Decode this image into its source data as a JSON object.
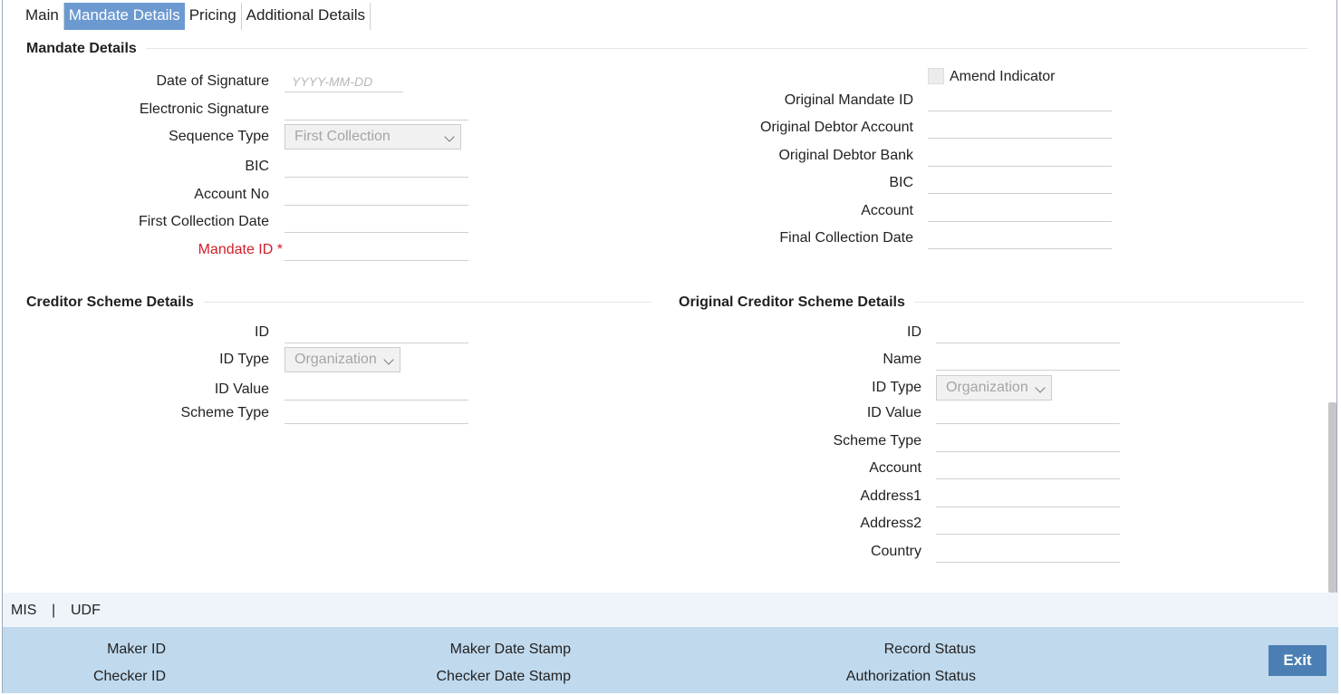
{
  "tabs": [
    {
      "label": "Main"
    },
    {
      "label": "Mandate Details"
    },
    {
      "label": "Pricing"
    },
    {
      "label": "Additional Details"
    }
  ],
  "mandate": {
    "title": "Mandate Details",
    "date_of_signature": {
      "label": "Date of Signature",
      "placeholder": "YYYY-MM-DD"
    },
    "electronic_signature": {
      "label": "Electronic Signature"
    },
    "sequence_type": {
      "label": "Sequence Type",
      "value": "First Collection"
    },
    "bic": {
      "label": "BIC"
    },
    "account_no": {
      "label": "Account No"
    },
    "first_collection_date": {
      "label": "First Collection Date"
    },
    "mandate_id": {
      "label": "Mandate ID",
      "required_mark": "*"
    },
    "amend_indicator": {
      "label": "Amend Indicator"
    },
    "original_mandate_id": {
      "label": "Original Mandate ID"
    },
    "original_debtor_account": {
      "label": "Original Debtor Account"
    },
    "original_debtor_bank": {
      "label": "Original Debtor Bank"
    },
    "orig_bic": {
      "label": "BIC"
    },
    "account": {
      "label": "Account"
    },
    "final_collection_date": {
      "label": "Final Collection Date"
    }
  },
  "creditor": {
    "title": "Creditor Scheme Details",
    "id": {
      "label": "ID"
    },
    "id_type": {
      "label": "ID Type",
      "value": "Organization"
    },
    "id_value": {
      "label": "ID Value"
    },
    "scheme_type": {
      "label": "Scheme Type"
    }
  },
  "orig_creditor": {
    "title": "Original Creditor Scheme Details",
    "id": {
      "label": "ID"
    },
    "name": {
      "label": "Name"
    },
    "id_type": {
      "label": "ID Type",
      "value": "Organization"
    },
    "id_value": {
      "label": "ID Value"
    },
    "scheme_type": {
      "label": "Scheme Type"
    },
    "account": {
      "label": "Account"
    },
    "address1": {
      "label": "Address1"
    },
    "address2": {
      "label": "Address2"
    },
    "country": {
      "label": "Country"
    }
  },
  "links": {
    "mis": "MIS",
    "separator": "|",
    "udf": "UDF"
  },
  "footer": {
    "maker_id": "Maker ID",
    "checker_id": "Checker ID",
    "maker_date_stamp": "Maker Date Stamp",
    "checker_date_stamp": "Checker Date Stamp",
    "record_status": "Record Status",
    "authorization_status": "Authorization Status",
    "exit_label": "Exit"
  },
  "colors": {
    "active_tab": "#6b99d0",
    "footer_bg": "#c0d9ed",
    "exit_button": "#4b7fb3",
    "required": "#d0202a"
  }
}
